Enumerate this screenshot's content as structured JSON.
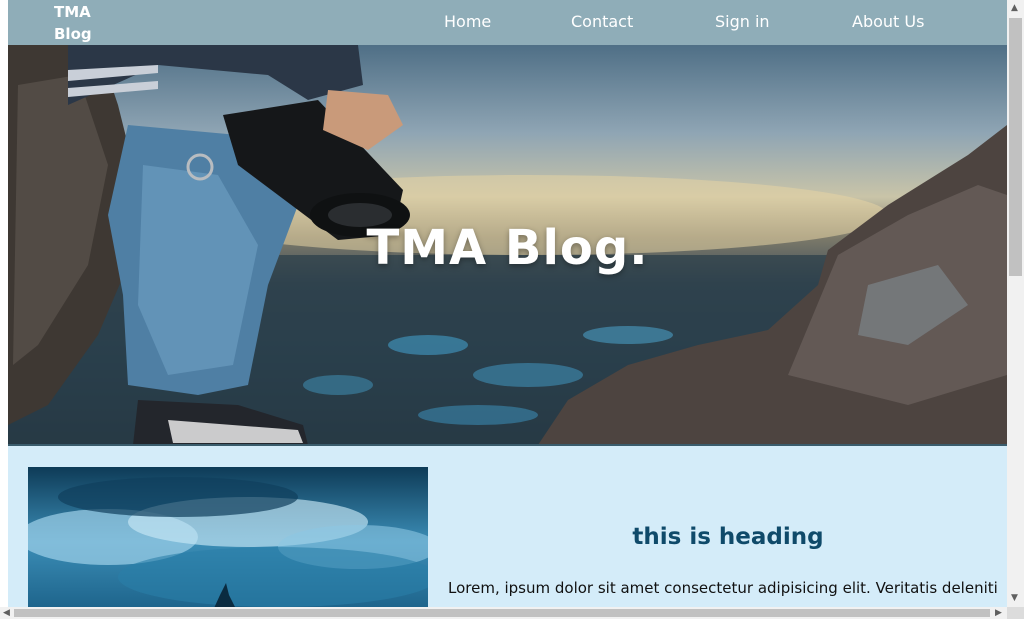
{
  "navbar": {
    "logo_line1": "TMA",
    "logo_line2": "Blog",
    "links": [
      "Home",
      "Contact",
      "Sign in",
      "About Us"
    ]
  },
  "hero": {
    "title": "TMA Blog."
  },
  "post": {
    "heading": "this is heading",
    "text": "Lorem, ipsum dolor sit amet consectetur adipisicing elit. Veritatis deleniti"
  },
  "colors": {
    "navbar_bg": "#8fadb8",
    "page_bg": "#d4ecf9",
    "heading_color": "#0f4a6a"
  },
  "icons": {
    "scroll_up": "triangle-up",
    "scroll_down": "triangle-down",
    "scroll_left": "triangle-left",
    "scroll_right": "triangle-right"
  }
}
